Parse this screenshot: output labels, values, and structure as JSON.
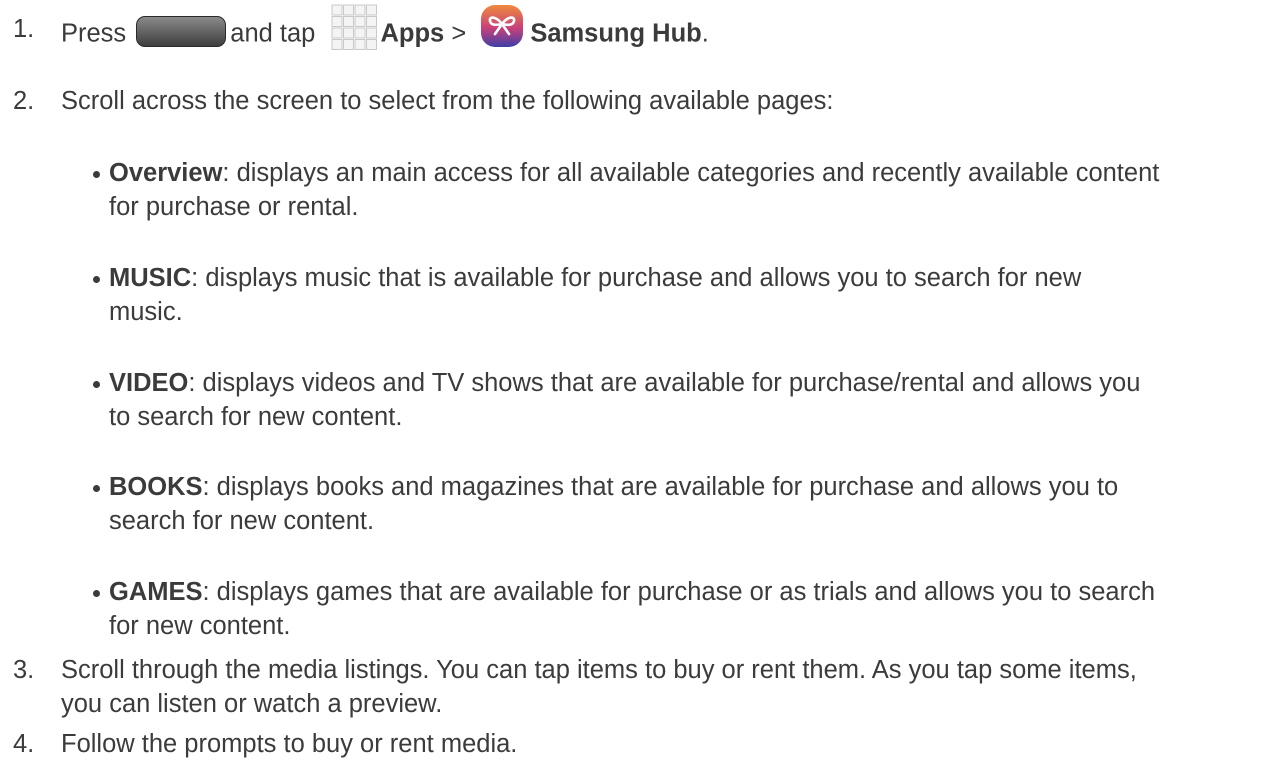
{
  "steps": [
    {
      "num": "1.",
      "press": "Press",
      "and_tap": "and tap",
      "apps": "Apps",
      "sep": ">",
      "samsung_hub": "Samsung Hub",
      "period": "."
    },
    {
      "num": "2.",
      "text": "Scroll across the screen to select from the following available pages:"
    },
    {
      "num": "3.",
      "line1": "Scroll through the media listings. You can tap items to buy or rent them. As you tap some items,",
      "line2": "you can listen or watch a preview."
    },
    {
      "num": "4.",
      "text": "Follow the prompts to buy or rent media."
    }
  ],
  "pages": [
    {
      "term": "Overview",
      "line1": ": displays an main access for all available categories and recently available content",
      "line2": "for purchase or rental."
    },
    {
      "term": "MUSIC",
      "line1": ": displays music that is available for purchase and allows you to search for new",
      "line2": "music."
    },
    {
      "term": "VIDEO",
      "line1": ": displays videos and TV shows that are available for purchase/rental and allows you",
      "line2": "to search for new content."
    },
    {
      "term": "BOOKS",
      "line1": ": displays books and magazines that are available for purchase and allows you to",
      "line2": "search for new content."
    },
    {
      "term": "GAMES",
      "line1": ": displays games that are available for purchase or as trials and allows you to search",
      "line2": "for new content."
    }
  ],
  "icons": {
    "home_key": "home-key-icon",
    "apps": "apps-grid-icon",
    "samsung_hub": "samsung-hub-icon"
  },
  "colors": {
    "text": "#3b3b3b",
    "hub_icon_top": "#f08a3c",
    "hub_icon_bottom": "#3d3fa8"
  }
}
